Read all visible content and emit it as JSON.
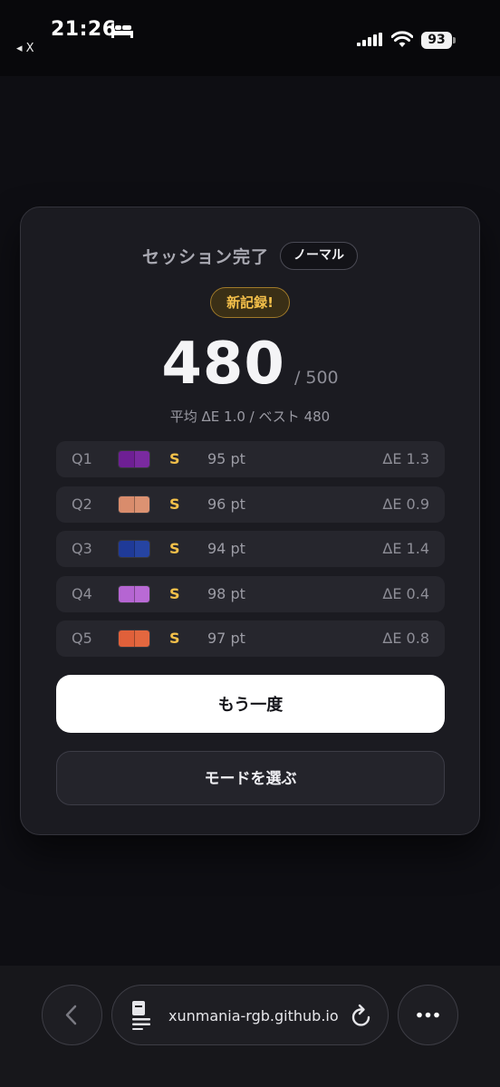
{
  "status_bar": {
    "time": "21:26",
    "back_app_label": "◂ X",
    "battery": "93"
  },
  "card": {
    "title": "セッション完了",
    "mode_badge": "ノーマル",
    "record_badge": "新記録!",
    "score": "480",
    "score_max": "/ 500",
    "summary": "平均 ΔE 1.0 / ベスト 480"
  },
  "results": [
    {
      "q": "Q1",
      "grade": "S",
      "points": "95 pt",
      "delta": "ΔE 1.3",
      "target_color": "#6e1f94",
      "guess_color": "#7a2aa0"
    },
    {
      "q": "Q2",
      "grade": "S",
      "points": "96 pt",
      "delta": "ΔE 0.9",
      "target_color": "#d98c6c",
      "guess_color": "#dc9272"
    },
    {
      "q": "Q3",
      "grade": "S",
      "points": "94 pt",
      "delta": "ΔE 1.4",
      "target_color": "#1f3a98",
      "guess_color": "#2644a2"
    },
    {
      "q": "Q4",
      "grade": "S",
      "points": "98 pt",
      "delta": "ΔE 0.4",
      "target_color": "#b565d2",
      "guess_color": "#b96ad5"
    },
    {
      "q": "Q5",
      "grade": "S",
      "points": "97 pt",
      "delta": "ΔE 0.8",
      "target_color": "#e0603a",
      "guess_color": "#e3673f"
    }
  ],
  "buttons": {
    "retry": "もう一度",
    "choose_mode": "モードを選ぶ"
  },
  "browser": {
    "url": "xunmania-rgb.github.io",
    "icons": [
      "chevron-left-icon",
      "tab-icon",
      "reload-icon",
      "more-icon"
    ]
  },
  "colors": {
    "grade": "#f3c04a",
    "record_badge": "#f5c04a",
    "card_bg": "#1b1b21"
  }
}
